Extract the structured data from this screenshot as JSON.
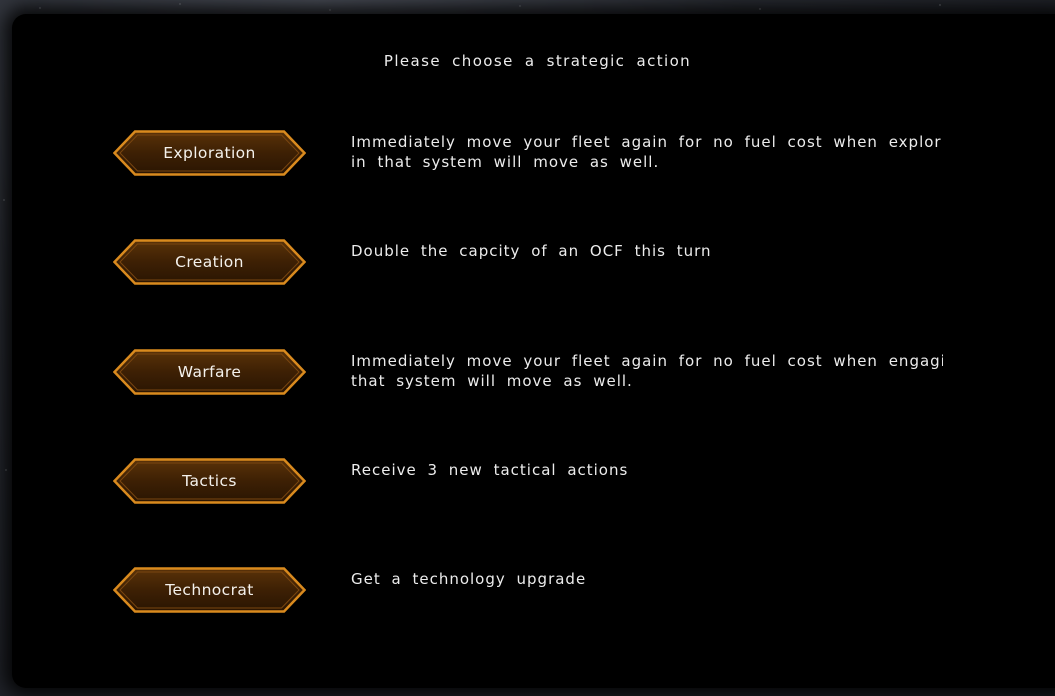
{
  "dialog": {
    "prompt": "Please choose a strategic action",
    "actions": [
      {
        "label": "Exploration",
        "description_lines": [
          "Immediately move your fleet again for no fuel cost when exploring",
          "in that system will move as well."
        ]
      },
      {
        "label": "Creation",
        "description_lines": [
          "Double the capcity of an OCF this turn",
          ""
        ]
      },
      {
        "label": "Warfare",
        "description_lines": [
          "Immediately move your fleet again for no fuel cost when engaging",
          "that system will move as well."
        ]
      },
      {
        "label": "Tactics",
        "description_lines": [
          "Receive 3 new tactical actions",
          ""
        ]
      },
      {
        "label": "Technocrat",
        "description_lines": [
          "Get a technology upgrade",
          ""
        ]
      }
    ]
  },
  "colors": {
    "button_border": "#d98a1e",
    "button_fill_top": "#5a3208",
    "button_fill_bottom": "#2a1502",
    "text": "#ececec",
    "panel": "#000000"
  }
}
